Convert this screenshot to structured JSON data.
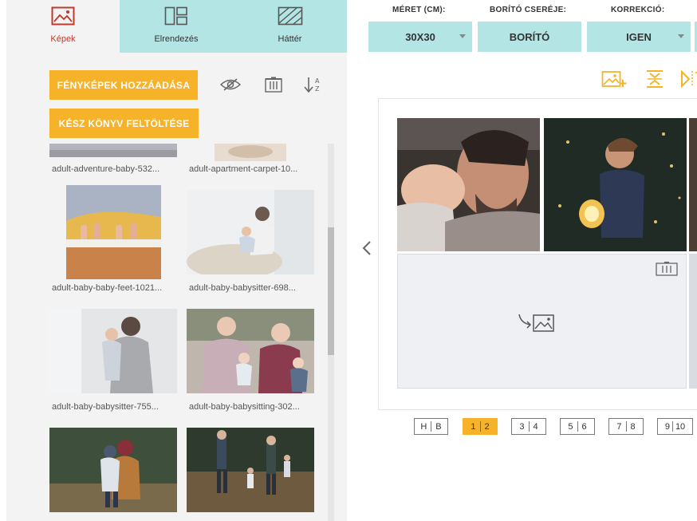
{
  "tabs": [
    {
      "label": "Képek",
      "icon": "image-icon"
    },
    {
      "label": "Elrendezés",
      "icon": "layout-icon"
    },
    {
      "label": "Háttér",
      "icon": "background-icon"
    }
  ],
  "buttons": {
    "add_photos": "FÉNYKÉPEK HOZZÁADÁSA",
    "upload_book": "KÉSZ KÖNYV FELTÖLTÉSE"
  },
  "photos": [
    {
      "name": "adult-adventure-baby-532..."
    },
    {
      "name": "adult-apartment-carpet-10..."
    },
    {
      "name": "adult-baby-baby-feet-1021..."
    },
    {
      "name": "adult-baby-babysitter-698..."
    },
    {
      "name": "adult-baby-babysitter-755..."
    },
    {
      "name": "adult-baby-babysitting-302..."
    }
  ],
  "options": {
    "size": {
      "label": "MÉRET (CM):",
      "value": "30X30"
    },
    "cover": {
      "label": "BORÍTÓ CSERÉJE:",
      "value": "BORÍTÓ"
    },
    "correction": {
      "label": "KORREKCIÓ:",
      "value": "IGEN"
    }
  },
  "pages": [
    {
      "left": "H",
      "right": "B"
    },
    {
      "left": "1",
      "right": "2"
    },
    {
      "left": "3",
      "right": "4"
    },
    {
      "left": "5",
      "right": "6"
    },
    {
      "left": "7",
      "right": "8"
    },
    {
      "left": "9",
      "right": "10"
    }
  ],
  "colors": {
    "accent": "#f6b228",
    "tab_bg": "#b3e5e5",
    "active_tab_text": "#c0392b"
  }
}
